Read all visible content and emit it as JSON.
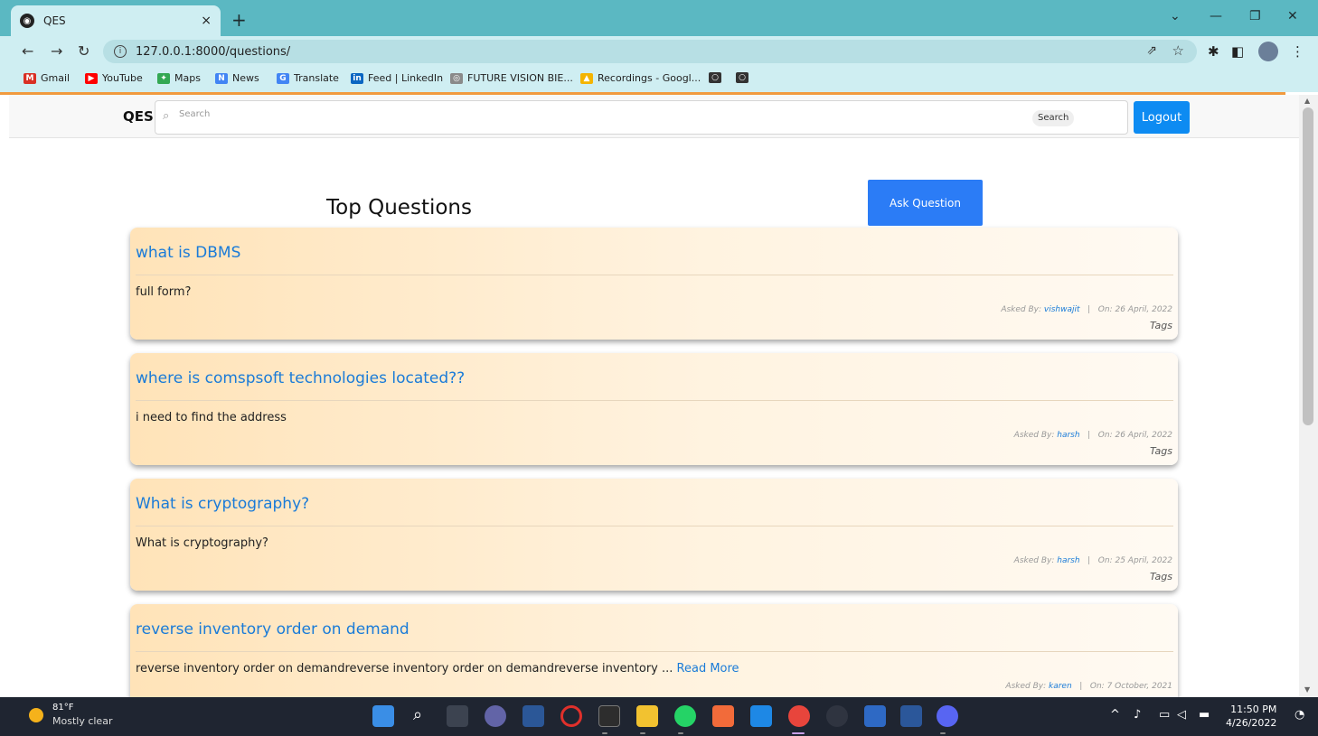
{
  "browser": {
    "tab_title": "QES",
    "tab_close": "×",
    "new_tab": "+",
    "url": "127.0.0.1:8000/questions/",
    "controls": {
      "minimize": "⌄",
      "min2": "—",
      "maximize": "❐",
      "close": "✕"
    },
    "bookmarks": [
      {
        "label": "Gmail",
        "icon": "gmail-icon",
        "color": "#d93025",
        "glyph": "M"
      },
      {
        "label": "YouTube",
        "icon": "youtube-icon",
        "color": "#ff0000",
        "glyph": "▶"
      },
      {
        "label": "Maps",
        "icon": "maps-icon",
        "color": "#34a853",
        "glyph": "✦"
      },
      {
        "label": "News",
        "icon": "news-icon",
        "color": "#4285f4",
        "glyph": "N"
      },
      {
        "label": "Translate",
        "icon": "translate-icon",
        "color": "#4285f4",
        "glyph": "G"
      },
      {
        "label": "Feed | LinkedIn",
        "icon": "linkedin-icon",
        "color": "#0a66c2",
        "glyph": "in"
      },
      {
        "label": "FUTURE VISION BIE...",
        "icon": "future-vision-icon",
        "color": "#8a8a8a",
        "glyph": "◎"
      },
      {
        "label": "Recordings - Googl...",
        "icon": "drive-icon",
        "color": "#f4b400",
        "glyph": "▲"
      },
      {
        "label": "",
        "icon": "github-icon",
        "color": "#333333",
        "glyph": "○"
      },
      {
        "label": "",
        "icon": "github-icon",
        "color": "#333333",
        "glyph": "○"
      }
    ]
  },
  "app": {
    "brand": "QES",
    "search_placeholder": "Search",
    "search_button": "Search",
    "logout": "Logout",
    "heading": "Top Questions",
    "ask_button": "Ask Question",
    "asked_by_label": "Asked By:",
    "on_label": "On:",
    "separator": "|",
    "tags_label": "Tags",
    "questions": [
      {
        "title": "what is DBMS",
        "body": "full form?",
        "read_more": "",
        "author": "vishwajit",
        "date": "26 April, 2022"
      },
      {
        "title": "where is comspsoft technologies located??",
        "body": "i need to find the address",
        "read_more": "",
        "author": "harsh",
        "date": "26 April, 2022"
      },
      {
        "title": "What is cryptography?",
        "body": "What is cryptography?",
        "read_more": "",
        "author": "harsh",
        "date": "25 April, 2022"
      },
      {
        "title": "reverse inventory order on demand",
        "body": "reverse inventory order on demandreverse inventory order on demandreverse inventory ...",
        "read_more": "Read More",
        "author": "karen",
        "date": "7 October, 2021"
      }
    ]
  },
  "taskbar": {
    "temperature": "81°F",
    "condition": "Mostly clear",
    "time": "11:50 PM",
    "date": "4/26/2022"
  },
  "colors": {
    "accent_blue": "#0d8bf2",
    "link_blue": "#1a7bd8",
    "card_gradient_start": "#ffe3b8",
    "chrome_teal": "#5bb8c2"
  }
}
